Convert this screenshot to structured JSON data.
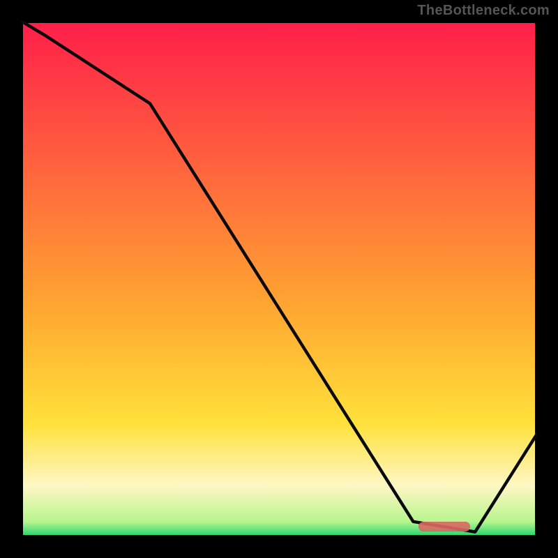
{
  "watermark": "TheBottleneck.com",
  "colors": {
    "bg": "#000000",
    "top": "#ff1e4a",
    "mid": "#ffa531",
    "yellow": "#ffe13a",
    "pale": "#fff7c4",
    "green": "#18d36b",
    "line": "#0a0a0a",
    "marker": "#dc6a63"
  },
  "chart_data": {
    "type": "line",
    "title": "",
    "xlabel": "",
    "ylabel": "",
    "xlim": [
      0,
      100
    ],
    "ylim": [
      0,
      100
    ],
    "categories": [
      0,
      5,
      25,
      76,
      88,
      100
    ],
    "values": [
      100,
      97,
      84,
      3,
      1,
      20
    ],
    "annotations": [
      {
        "type": "marker-bar",
        "x0": 77,
        "x1": 87,
        "y": 2
      }
    ],
    "gradient_stops": [
      {
        "pos": 0,
        "color": "#ff1e4a"
      },
      {
        "pos": 0.55,
        "color": "#ffa531"
      },
      {
        "pos": 0.78,
        "color": "#ffe13a"
      },
      {
        "pos": 0.9,
        "color": "#fff7c4"
      },
      {
        "pos": 0.97,
        "color": "#b8f58e"
      },
      {
        "pos": 1.0,
        "color": "#18d36b"
      }
    ]
  }
}
